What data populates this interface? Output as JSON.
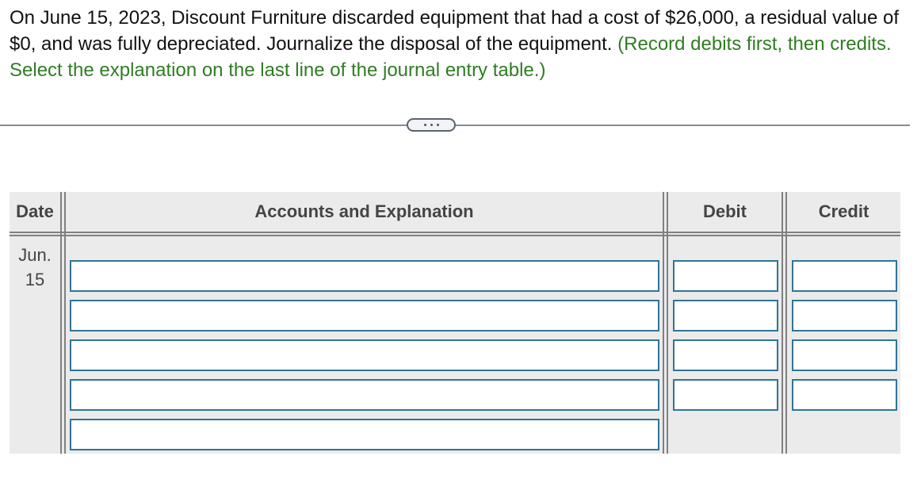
{
  "question": {
    "text": "On June 15, 2023, Discount Furniture discarded equipment that had a cost of $26,000, a residual value of $0, and was fully depreciated. Journalize the disposal of the equipment.",
    "hint": "(Record debits first, then credits. Select the explanation on the last line of the journal entry table.)"
  },
  "expand_button": {
    "icon": "ellipsis-icon"
  },
  "journal": {
    "headers": {
      "date": "Date",
      "accounts": "Accounts and Explanation",
      "debit": "Debit",
      "credit": "Credit"
    },
    "date": {
      "month": "Jun.",
      "day": "15"
    },
    "rows": [
      {
        "account": "",
        "debit": "",
        "credit": ""
      },
      {
        "account": "",
        "debit": "",
        "credit": ""
      },
      {
        "account": "",
        "debit": "",
        "credit": ""
      },
      {
        "account": "",
        "debit": "",
        "credit": ""
      },
      {
        "account": ""
      }
    ]
  },
  "colors": {
    "hint_green": "#2f7d22",
    "input_border": "#2f7596",
    "table_bg": "#ebebeb",
    "grid_line": "#808080"
  }
}
